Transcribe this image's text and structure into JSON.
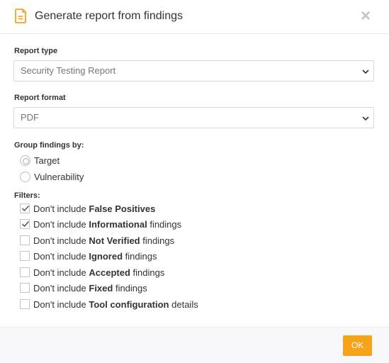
{
  "dialog": {
    "title": "Generate report from findings",
    "close_glyph": "×"
  },
  "report_type": {
    "label": "Report type",
    "selected": "Security Testing Report"
  },
  "report_format": {
    "label": "Report format",
    "selected": "PDF"
  },
  "group_by": {
    "label": "Group findings by:",
    "options": [
      {
        "label": "Target",
        "checked": true
      },
      {
        "label": "Vulnerability",
        "checked": false
      }
    ]
  },
  "filters": {
    "label": "Filters:",
    "items": [
      {
        "prefix": "Don't include ",
        "bold": "False Positives",
        "suffix": "",
        "checked": true
      },
      {
        "prefix": "Don't include ",
        "bold": "Informational",
        "suffix": " findings",
        "checked": true
      },
      {
        "prefix": "Don't include ",
        "bold": "Not Verified",
        "suffix": " findings",
        "checked": false
      },
      {
        "prefix": "Don't include ",
        "bold": "Ignored",
        "suffix": " findings",
        "checked": false
      },
      {
        "prefix": "Don't include ",
        "bold": "Accepted",
        "suffix": " findings",
        "checked": false
      },
      {
        "prefix": "Don't include ",
        "bold": "Fixed",
        "suffix": " findings",
        "checked": false
      },
      {
        "prefix": "Don't include ",
        "bold": "Tool configuration",
        "suffix": " details",
        "checked": false
      }
    ]
  },
  "footer": {
    "ok_label": "OK"
  },
  "colors": {
    "accent": "#f7a21b",
    "icon": "#f7a21b"
  },
  "icons": [
    "document-icon",
    "close-icon",
    "chevron-down-icon",
    "checkmark-icon"
  ]
}
